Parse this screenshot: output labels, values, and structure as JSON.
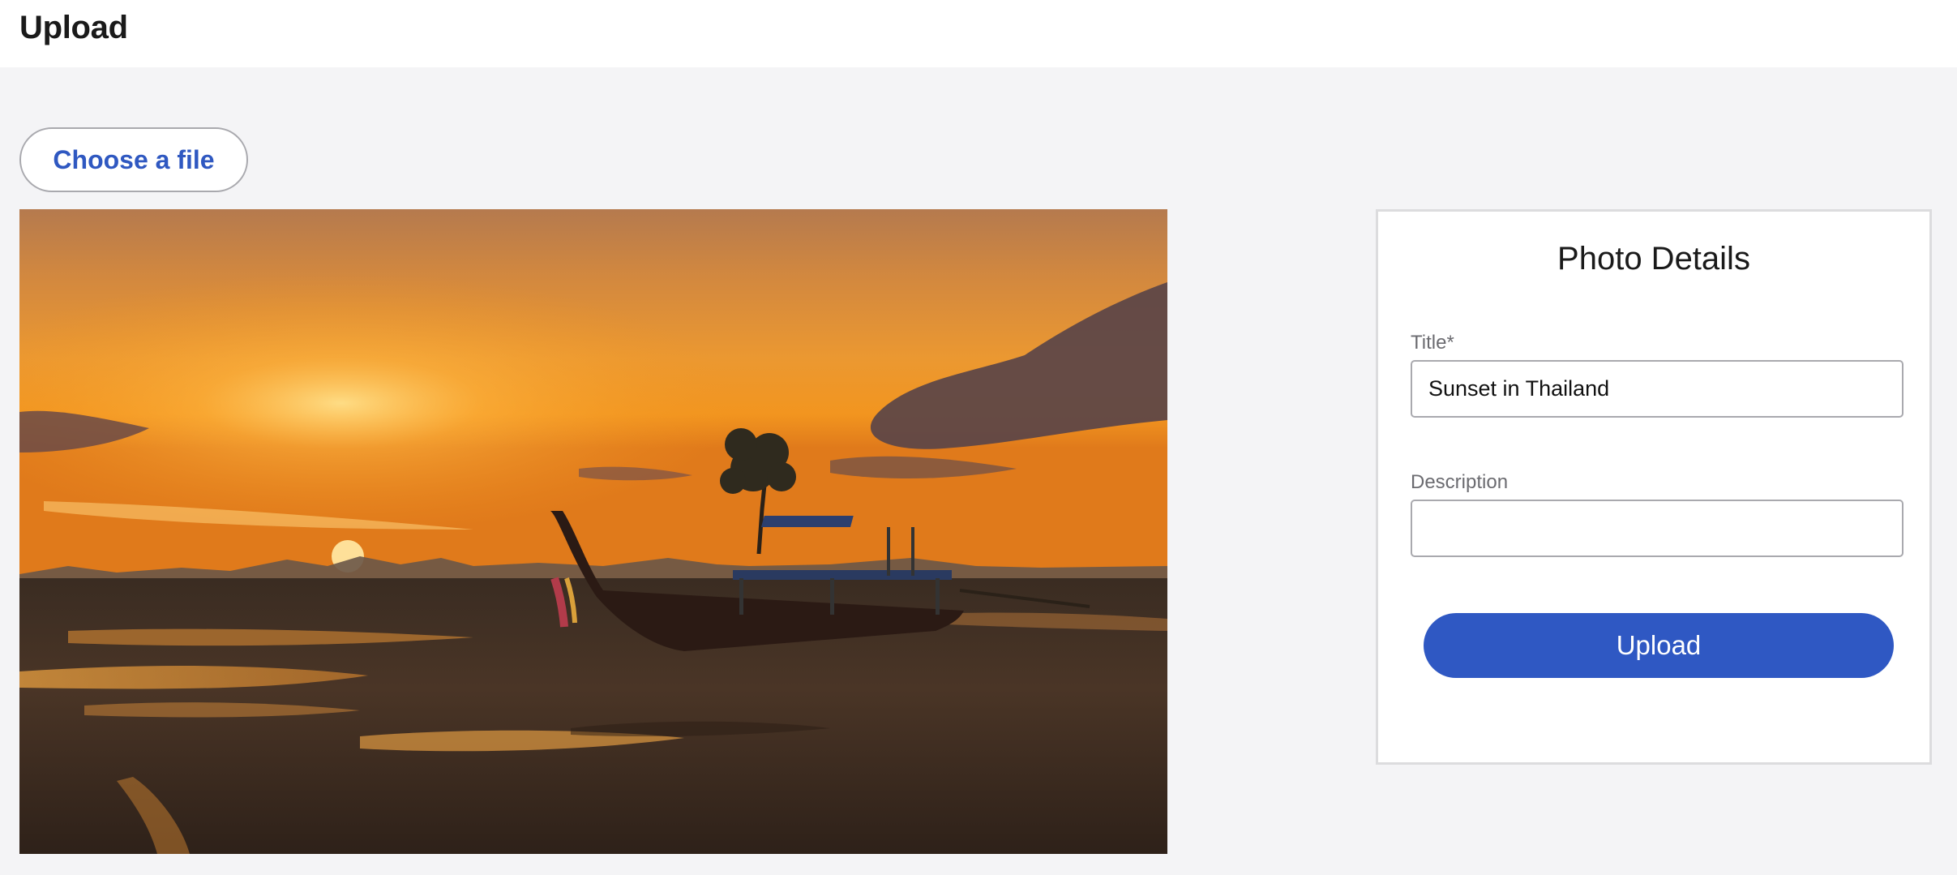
{
  "header": {
    "title": "Upload"
  },
  "file_picker": {
    "label": "Choose a file"
  },
  "photo": {
    "description": "Sunset in Thailand"
  },
  "details": {
    "heading": "Photo Details",
    "title_field": {
      "label": "Title*",
      "value": "Sunset in Thailand"
    },
    "description_field": {
      "label": "Description",
      "value": "",
      "placeholder": ""
    },
    "submit_label": "Upload"
  },
  "colors": {
    "accent": "#2f58c3",
    "page_background": "#f4f4f6",
    "surface": "#ffffff",
    "border": "#a9a9ae"
  }
}
